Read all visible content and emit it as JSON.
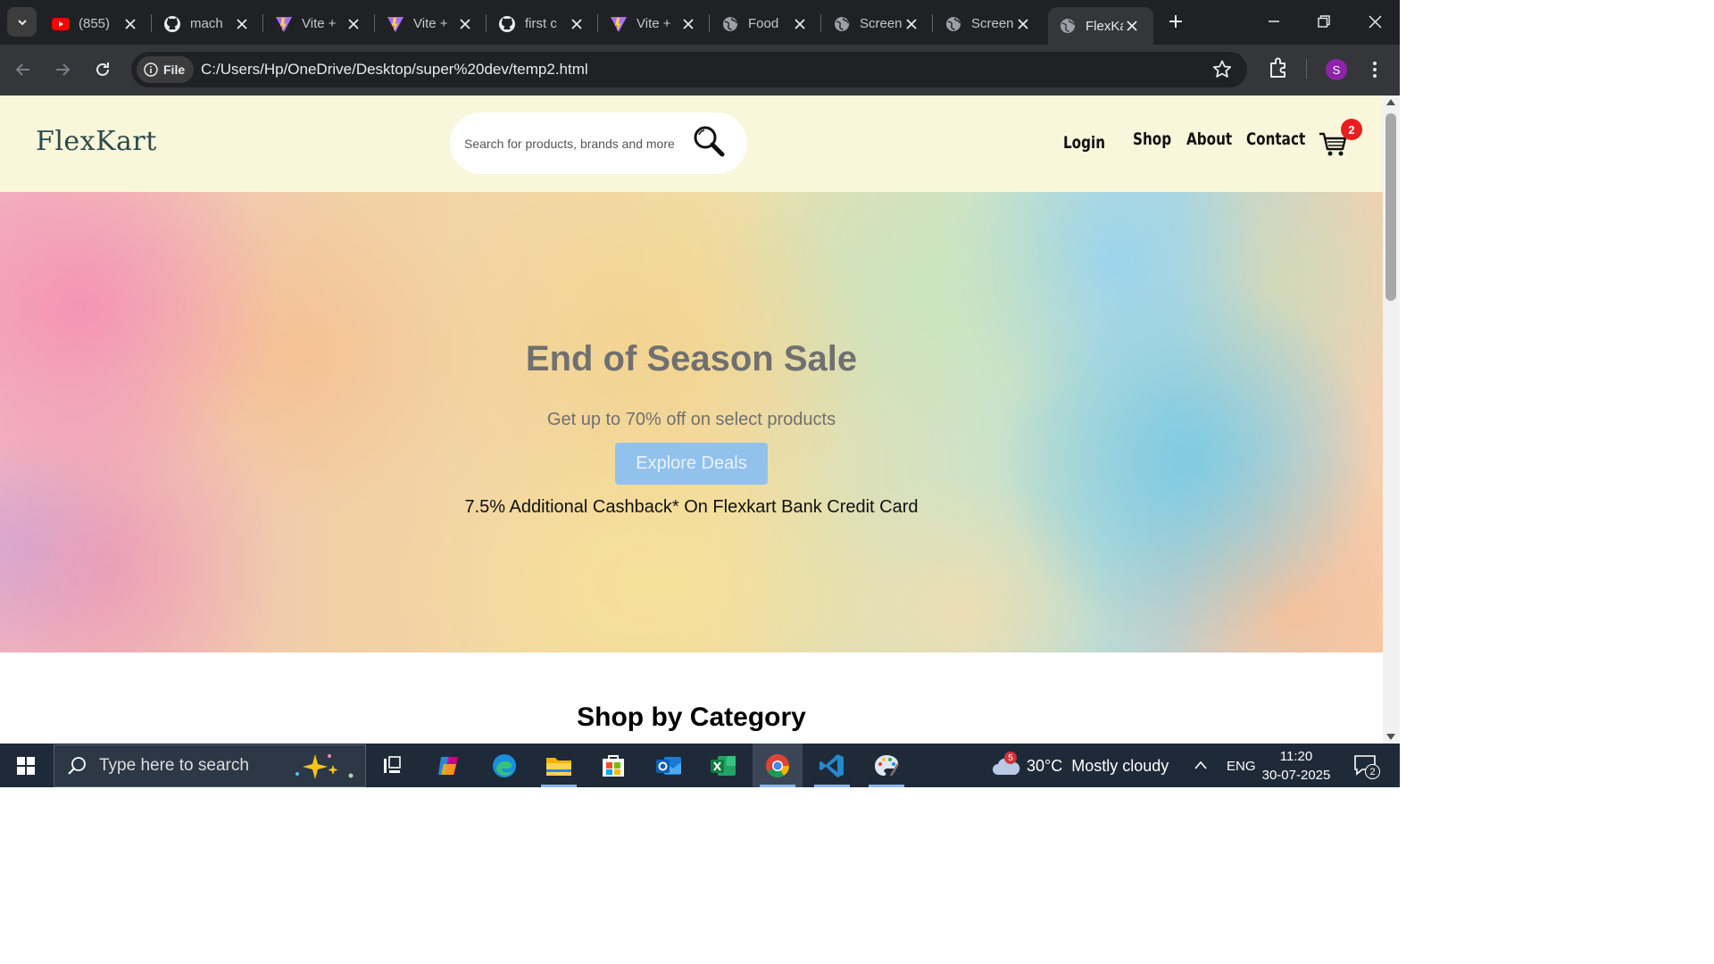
{
  "browser": {
    "tabs": [
      {
        "title": "(855)",
        "favicon": "youtube-icon"
      },
      {
        "title": "mach",
        "favicon": "github-icon"
      },
      {
        "title": "Vite +",
        "favicon": "vite-icon"
      },
      {
        "title": "Vite +",
        "favicon": "vite-icon"
      },
      {
        "title": "first c",
        "favicon": "github-icon"
      },
      {
        "title": "Vite +",
        "favicon": "vite-icon"
      },
      {
        "title": "Food",
        "favicon": "globe-icon"
      },
      {
        "title": "Screen",
        "favicon": "globe-icon"
      },
      {
        "title": "Screen",
        "favicon": "globe-icon"
      },
      {
        "title": "FlexKa",
        "favicon": "globe-icon",
        "active": true
      }
    ],
    "file_chip": "File",
    "url": "C:/Users/Hp/OneDrive/Desktop/super%20dev/temp2.html",
    "profile_initial": "S"
  },
  "site": {
    "logo": "FlexKart",
    "search_placeholder": "Search for products, brands and more",
    "nav": {
      "login": "Login",
      "shop": "Shop",
      "about": "About",
      "contact": "Contact"
    },
    "cart_count": "2"
  },
  "hero": {
    "title": "End of Season Sale",
    "subtitle": "Get up to 70% off on select products",
    "button": "Explore Deals",
    "cashback": "7.5% Additional Cashback* On Flexkart Bank Credit Card"
  },
  "section": {
    "title": "Shop by Category"
  },
  "taskbar": {
    "search_placeholder": "Type here to search",
    "weather_temp": "30°C",
    "weather_desc": "Mostly cloudy",
    "weather_badge": "5",
    "language": "ENG",
    "time": "11:20",
    "date": "30-07-2025",
    "notification_count": "2"
  },
  "colors": {
    "header_bg": "#f8f7dc",
    "button_bg": "#92c1ee",
    "badge": "#e91e1e"
  }
}
